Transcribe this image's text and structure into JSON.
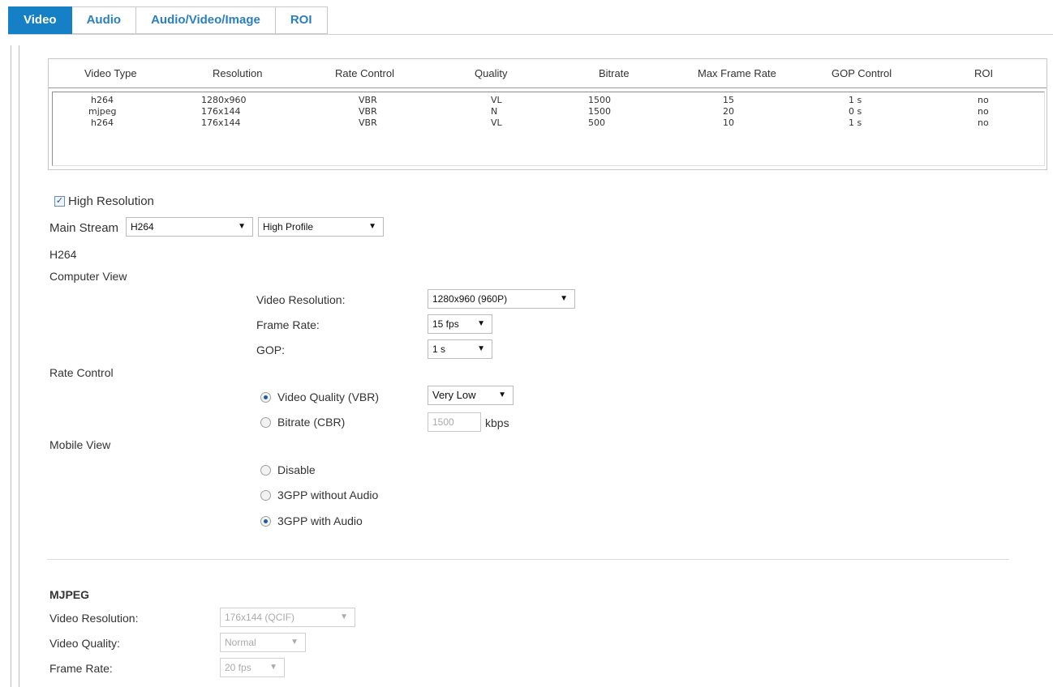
{
  "tabs": [
    {
      "label": "Video",
      "active": true
    },
    {
      "label": "Audio",
      "active": false
    },
    {
      "label": "Audio/Video/Image",
      "active": false
    },
    {
      "label": "ROI",
      "active": false
    }
  ],
  "stream_table": {
    "headers": [
      "Video Type",
      "Resolution",
      "Rate Control",
      "Quality",
      "Bitrate",
      "Max Frame Rate",
      "GOP Control",
      "ROI"
    ],
    "rows": [
      [
        "h264",
        "1280x960",
        "VBR",
        "VL",
        "1500",
        "15",
        "1 s",
        "no"
      ],
      [
        "mjpeg",
        "176x144",
        "VBR",
        "N",
        "1500",
        "20",
        "0 s",
        "no"
      ],
      [
        "h264",
        "176x144",
        "VBR",
        "VL",
        "500",
        "10",
        "1 s",
        "no"
      ]
    ]
  },
  "high_resolution": {
    "label": "High Resolution",
    "checked": true
  },
  "main_stream": {
    "label": "Main Stream",
    "codec": "H264",
    "profile": "High Profile"
  },
  "h264_section": {
    "title": "H264",
    "computer_view": "Computer View",
    "video_resolution_label": "Video Resolution:",
    "video_resolution_value": "1280x960 (960P)",
    "frame_rate_label": "Frame Rate:",
    "frame_rate_value": "15 fps",
    "gop_label": "GOP:",
    "gop_value": "1 s",
    "rate_control": "Rate Control",
    "vbr_label": "Video Quality (VBR)",
    "vbr_value": "Very Low",
    "cbr_label": "Bitrate (CBR)",
    "cbr_value": "1500",
    "cbr_unit": "kbps",
    "mobile_view": "Mobile View",
    "mobile_options": [
      "Disable",
      "3GPP without Audio",
      "3GPP with Audio"
    ],
    "mobile_selected": "3GPP with Audio"
  },
  "mjpeg_section": {
    "title": "MJPEG",
    "video_resolution_label": "Video Resolution:",
    "video_resolution_value": "176x144 (QCIF)",
    "video_quality_label": "Video Quality:",
    "video_quality_value": "Normal",
    "frame_rate_label": "Frame Rate:",
    "frame_rate_value": "20 fps"
  },
  "colors": {
    "tab_active": "#1580c6",
    "tab_text": "#2a7fc0"
  }
}
